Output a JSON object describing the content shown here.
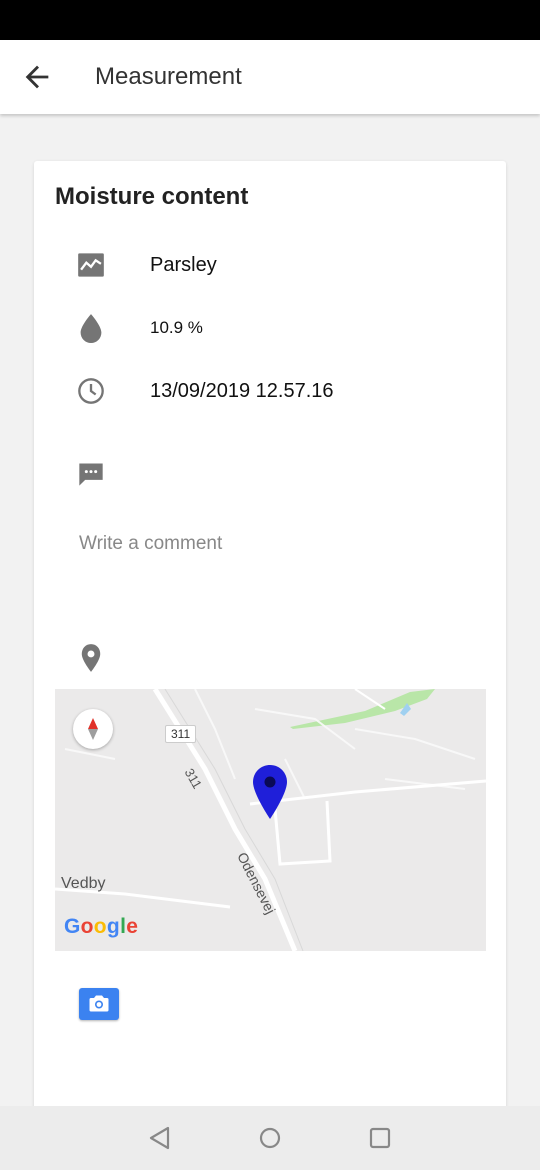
{
  "app_bar": {
    "title": "Measurement"
  },
  "card": {
    "title": "Moisture content",
    "product": "Parsley",
    "moisture": "10.9 %",
    "timestamp": "13/09/2019 12.57.16",
    "comment_placeholder": "Write a comment"
  },
  "map": {
    "road_number": "311",
    "road_label_rotated": "311",
    "street_label": "Odensevej",
    "place_label": "Vedby",
    "logo": "Google"
  },
  "icons": {
    "back": "arrow-back-icon",
    "product": "trend-chart-icon",
    "moisture": "water-drop-icon",
    "time": "clock-icon",
    "comment": "comment-icon",
    "location": "location-pin-icon",
    "camera": "camera-icon"
  },
  "colors": {
    "accent": "#3b82f0",
    "map_marker": "#1f1fd9",
    "icon_gray": "#757575"
  }
}
